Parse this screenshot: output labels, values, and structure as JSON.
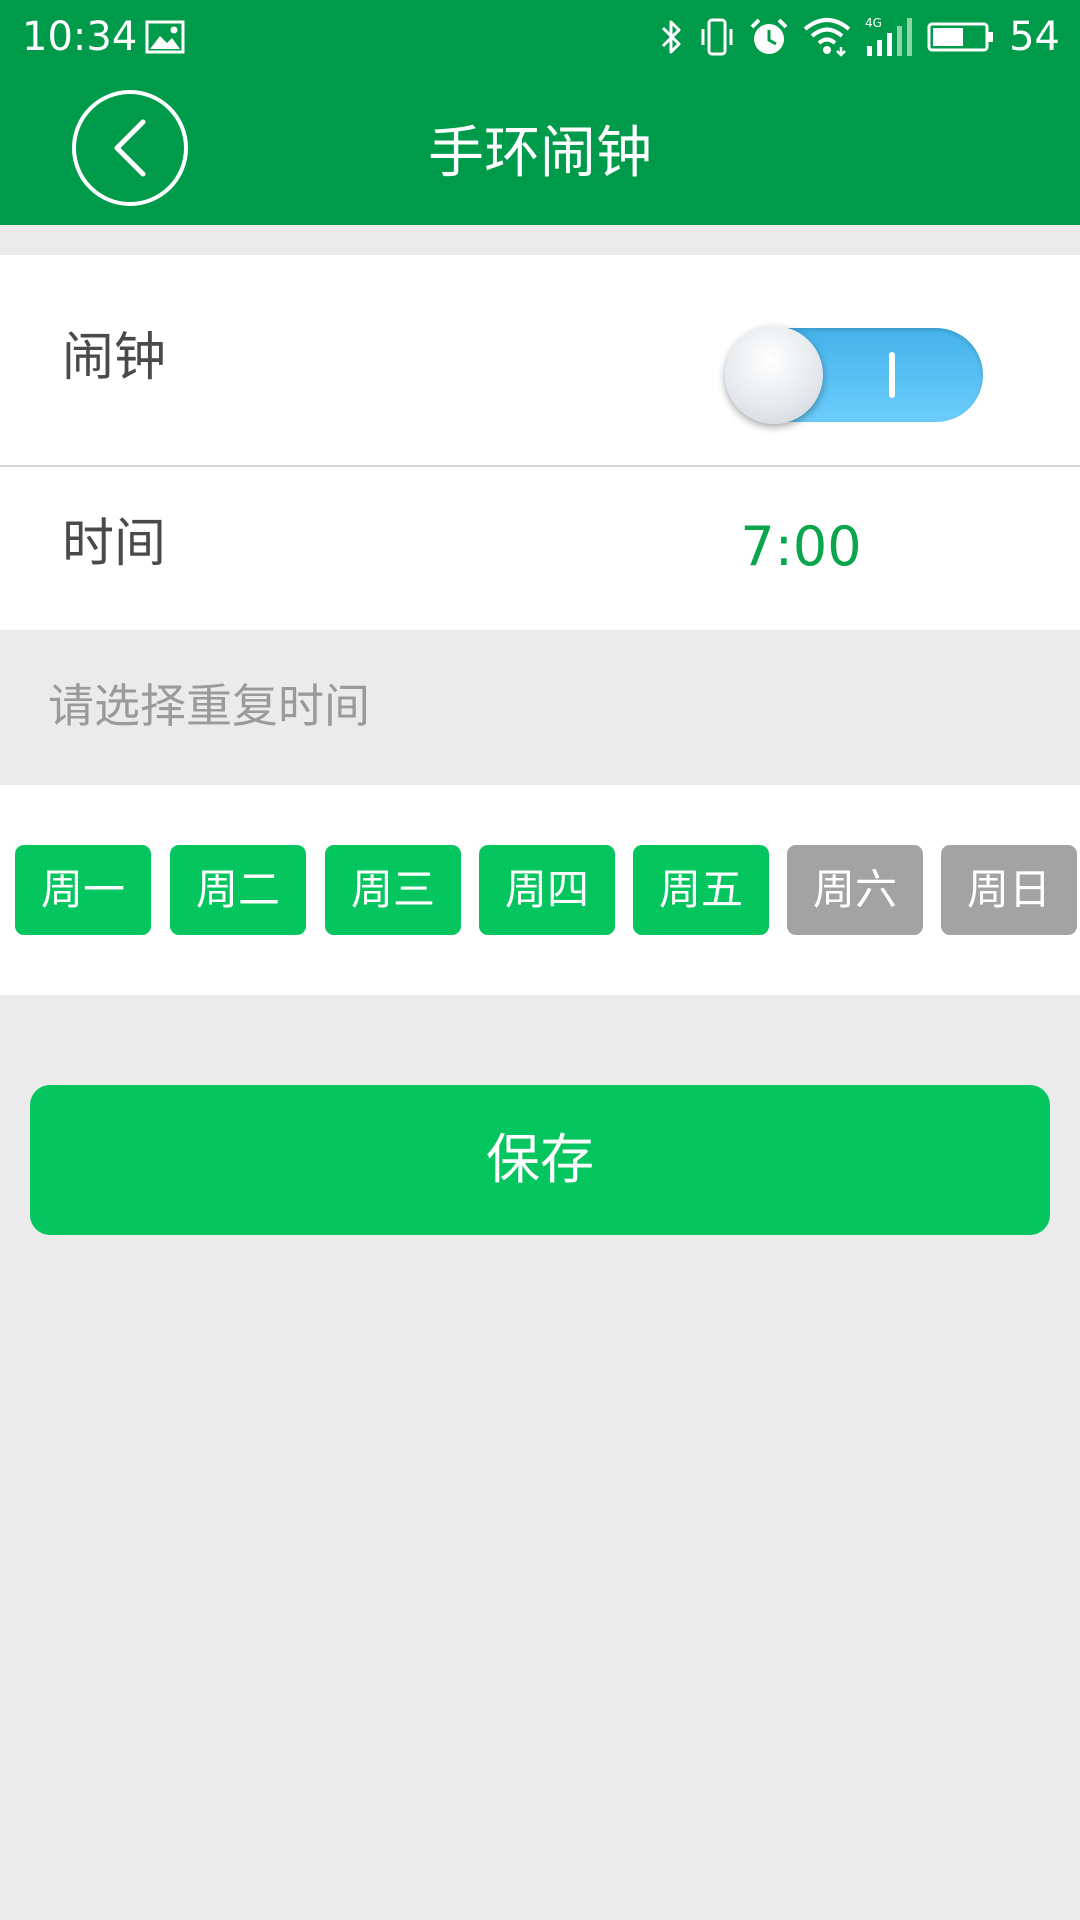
{
  "status_bar": {
    "time": "10:34",
    "battery_level": "54",
    "icons": [
      "gallery-icon",
      "bluetooth-icon",
      "vibrate-icon",
      "alarm-clock-icon",
      "wifi-icon",
      "signal-4g-icon",
      "battery-icon"
    ]
  },
  "header": {
    "title": "手环闹钟",
    "back_icon": "chevron-left-icon"
  },
  "alarm": {
    "label": "闹钟",
    "enabled": true,
    "toggle_color": "#45b2ea"
  },
  "time": {
    "label": "时间",
    "value": "7:00"
  },
  "repeat": {
    "hint": "请选择重复时间",
    "days": [
      {
        "label": "周一",
        "selected": true
      },
      {
        "label": "周二",
        "selected": true
      },
      {
        "label": "周三",
        "selected": true
      },
      {
        "label": "周四",
        "selected": true
      },
      {
        "label": "周五",
        "selected": true
      },
      {
        "label": "周六",
        "selected": false
      },
      {
        "label": "周日",
        "selected": false
      }
    ]
  },
  "save_label": "保存",
  "colors": {
    "header_green": "#009b4a",
    "accent_green": "#05c65e",
    "time_green": "#0aa64c",
    "day_off_gray": "#a3a3a3",
    "background": "#ebebeb"
  }
}
